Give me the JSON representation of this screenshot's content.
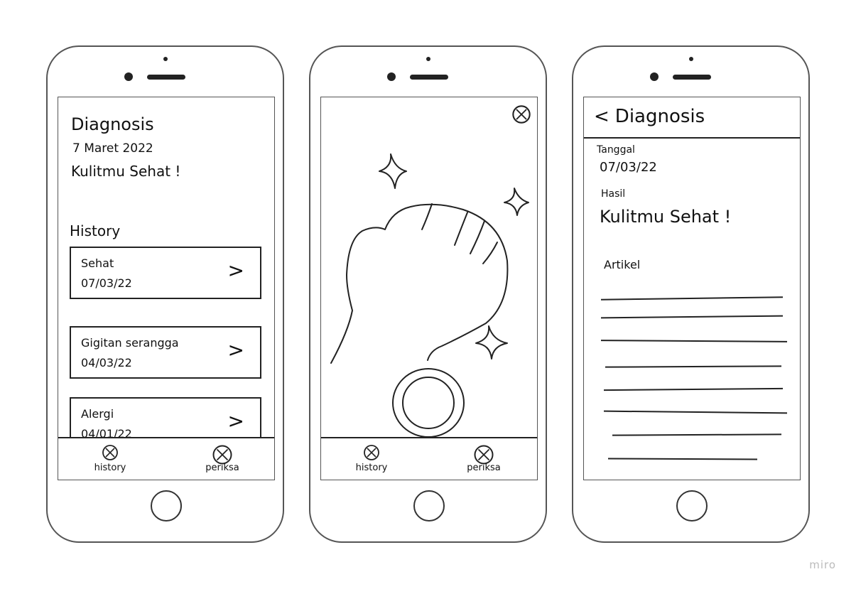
{
  "screen1": {
    "title": "Diagnosis",
    "date": "7 Maret 2022",
    "status": "Kulitmu Sehat !",
    "history_heading": "History",
    "items": [
      {
        "label": "Sehat",
        "date": "07/03/22"
      },
      {
        "label": "Gigitan serangga",
        "date": "04/03/22"
      },
      {
        "label": "Alergi",
        "date": "04/01/22"
      }
    ],
    "chevron": ">"
  },
  "nav": {
    "history_label": "history",
    "periksa_label": "periksa"
  },
  "screen3": {
    "back_icon": "<",
    "title": "Diagnosis",
    "tanggal_label": "Tanggal",
    "tanggal_value": "07/03/22",
    "hasil_label": "Hasil",
    "hasil_value": "Kulitmu Sehat !",
    "artikel_label": "Artikel"
  },
  "watermark": "miro"
}
